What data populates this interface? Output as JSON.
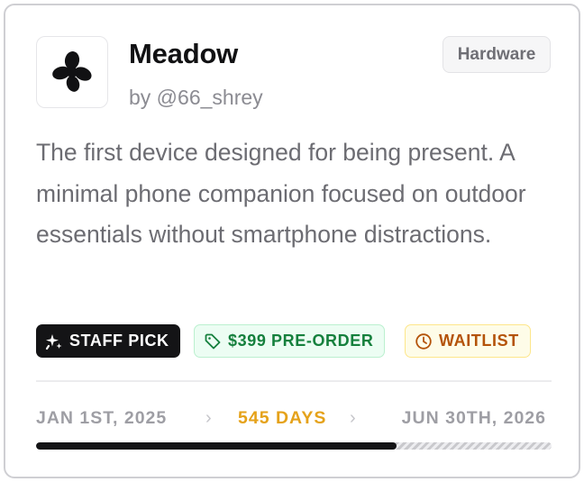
{
  "product": {
    "name": "Meadow",
    "author": "by @66_shrey",
    "category": "Hardware",
    "description": "The first device designed for being present. A minimal phone companion focused on outdoor essentials without smartphone distractions.",
    "logo_icon": "clover-icon"
  },
  "badges": {
    "staff_pick": "STAFF PICK",
    "price": "$399 PRE-ORDER",
    "status": "WAITLIST"
  },
  "timeline": {
    "start": "JAN 1ST, 2025",
    "duration": "545 DAYS",
    "end": "JUN 30TH, 2026",
    "separator": "›",
    "progress": 0.7
  },
  "colors": {
    "staff_bg": "#141416",
    "price_text": "#15803d",
    "price_bg": "#ecfdf3",
    "wait_text": "#b45309",
    "wait_bg": "#fefce8",
    "days_accent": "#e5a21a"
  }
}
